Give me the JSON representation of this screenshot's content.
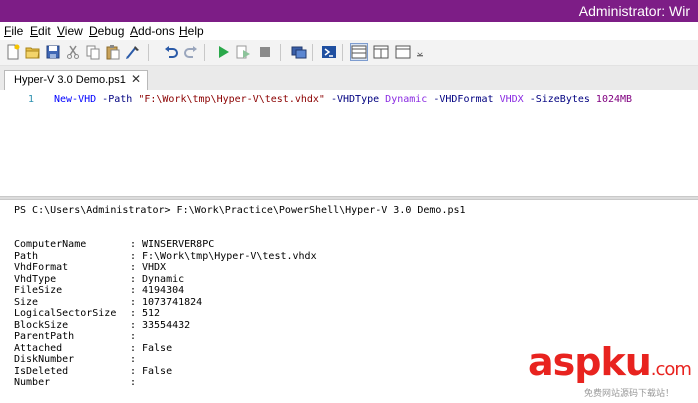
{
  "window": {
    "title": "Administrator: Wir"
  },
  "menu": {
    "items": [
      {
        "u": "F",
        "rest": "ile"
      },
      {
        "u": "E",
        "rest": "dit"
      },
      {
        "u": "V",
        "rest": "iew"
      },
      {
        "u": "D",
        "rest": "ebug"
      },
      {
        "u": "A",
        "rest": "dd-ons"
      },
      {
        "u": "H",
        "rest": "elp"
      }
    ]
  },
  "toolbar": {
    "icons": [
      "new-file-icon",
      "open-folder-icon",
      "save-icon",
      "cut-icon",
      "copy-icon",
      "paste-icon",
      "clear-icon",
      "undo-icon",
      "redo-icon",
      "run-icon",
      "run-selection-icon",
      "stop-icon",
      "remote-powershell-icon",
      "powershell-console-icon",
      "layout-top-icon",
      "layout-right-icon",
      "layout-max-icon"
    ]
  },
  "tab": {
    "label": "Hyper-V 3.0 Demo.ps1",
    "close": "✕"
  },
  "editor": {
    "line_number": "1",
    "code": {
      "cmd": "New-VHD",
      "p1": " -Path ",
      "path": "\"F:\\Work\\tmp\\Hyper-V\\test.vhdx\"",
      "p2": " -VHDType ",
      "type": "Dynamic",
      "p3": " -VHDFormat ",
      "format": "VHDX",
      "p4": " -SizeBytes ",
      "size": "1024MB"
    }
  },
  "console": {
    "prompt": "PS C:\\Users\\Administrator> F:\\Work\\Practice\\PowerShell\\Hyper-V 3.0 Demo.ps1",
    "properties": [
      {
        "key": "ComputerName",
        "value": "WINSERVER8PC"
      },
      {
        "key": "Path",
        "value": "F:\\Work\\tmp\\Hyper-V\\test.vhdx"
      },
      {
        "key": "VhdFormat",
        "value": "VHDX"
      },
      {
        "key": "VhdType",
        "value": "Dynamic"
      },
      {
        "key": "FileSize",
        "value": "4194304"
      },
      {
        "key": "Size",
        "value": "1073741824"
      },
      {
        "key": "LogicalSectorSize",
        "value": "512"
      },
      {
        "key": "BlockSize",
        "value": "33554432"
      },
      {
        "key": "ParentPath",
        "value": ""
      },
      {
        "key": "Attached",
        "value": "False"
      },
      {
        "key": "DiskNumber",
        "value": ""
      },
      {
        "key": "IsDeleted",
        "value": "False"
      },
      {
        "key": "Number",
        "value": ""
      }
    ],
    "separator": ":"
  },
  "watermark": {
    "asp": "asp",
    "ku": "ku",
    "com": ".com",
    "tagline": "免费网站源码下载站！"
  }
}
